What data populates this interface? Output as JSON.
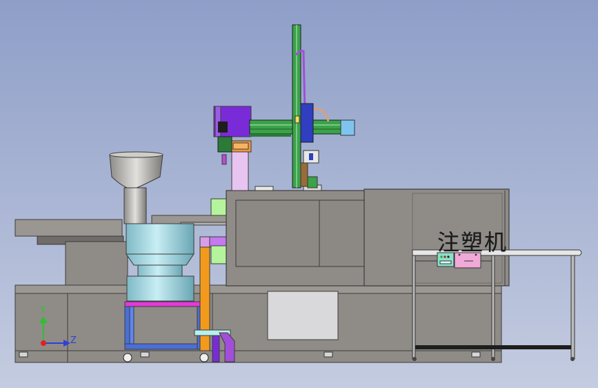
{
  "machine_label": "注塑机",
  "triad": {
    "y_label": "Y",
    "z_label": "Z"
  },
  "colors": {
    "background_top": "#8e9ec8",
    "background_bottom": "#bfc8de",
    "machine_body": "#8f8c88",
    "machine_dark": "#6d6a67",
    "bowl_cyan": "#9fd6e0",
    "feeder_silver": "#b8b6b2",
    "motor_purple": "#7a2bd8",
    "robot_green": "#3ba24a",
    "carriage_blue": "#2f3fbf",
    "pink_panel": "#f0a9d8",
    "orange_chute": "#f29a1c",
    "magenta_frame": "#e23ad8",
    "lime_block": "#a8f08c",
    "lilac_column": "#e8c4f0"
  }
}
